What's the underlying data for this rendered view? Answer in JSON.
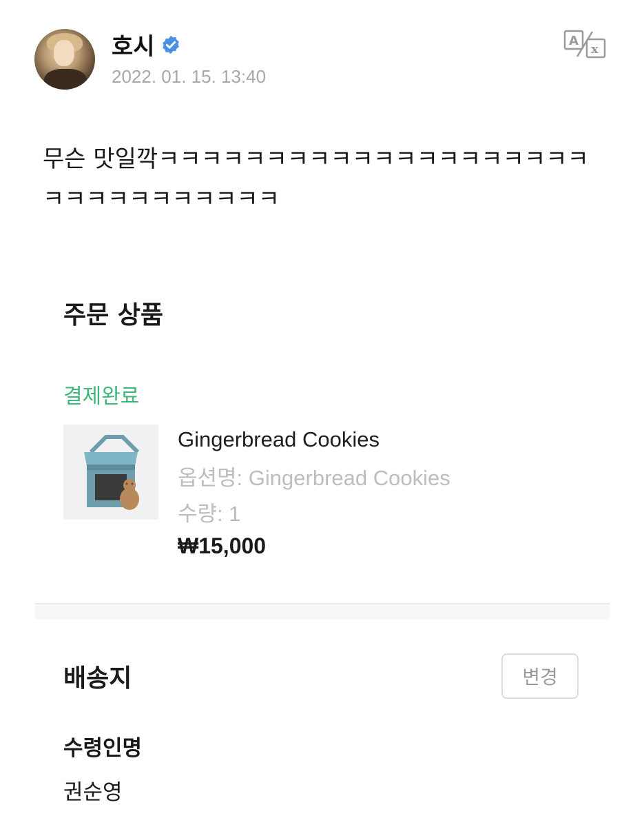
{
  "post": {
    "username": "호시",
    "timestamp": "2022. 01. 15. 13:40",
    "text": "무슨 맛일깍ㅋㅋㅋㅋㅋㅋㅋㅋㅋㅋㅋㅋㅋㅋㅋㅋㅋㅋㅋㅋㅋㅋㅋㅋㅋㅋㅋㅋㅋㅋㅋ"
  },
  "icons": {
    "verified": "verified-badge-icon",
    "translate": "translate-icon",
    "accent_blue": "#4a90e2"
  },
  "order": {
    "section_title": "주문 상품",
    "status": "결제완료",
    "status_color": "#3cb87a",
    "product": {
      "name": "Gingerbread Cookies",
      "option": "옵션명: Gingerbread Cookies",
      "quantity": "수량: 1",
      "price": "₩15,000"
    }
  },
  "shipping": {
    "section_title": "배송지",
    "change_label": "변경",
    "recipient_label": "수령인명",
    "recipient_name": "권순영"
  }
}
